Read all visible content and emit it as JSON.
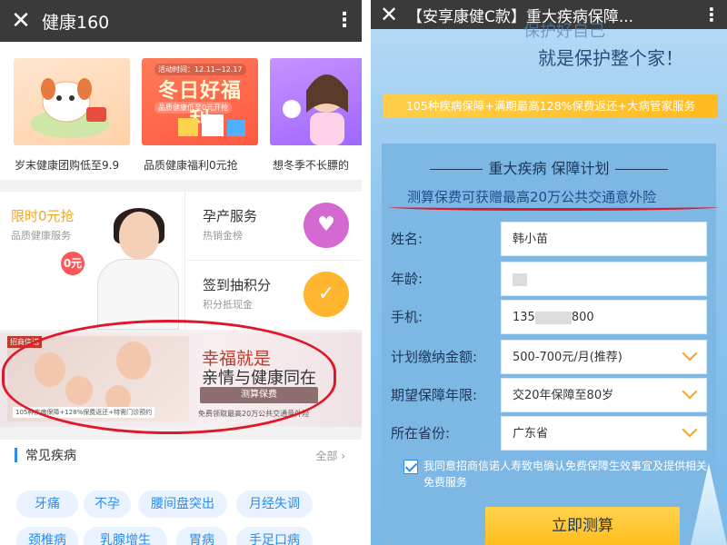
{
  "left": {
    "topbar": {
      "title": "健康160"
    },
    "banners": [
      {
        "caption": "岁末健康团购低至9.9"
      },
      {
        "caption": "品质健康福利0元抢",
        "tag": "活动时间：12.11~12.17",
        "big": "冬日好福利",
        "sub": "品质健康低至0元开抢"
      },
      {
        "caption": "想冬季不长膘的"
      }
    ],
    "grid": {
      "free": {
        "title": "限时0元抢",
        "sub": "品质健康服务",
        "badge": "0元"
      },
      "maternity": {
        "title": "孕产服务",
        "sub": "热销金榜"
      },
      "checkin": {
        "title": "签到抽积分",
        "sub": "积分抵现金"
      }
    },
    "ad": {
      "brand": "招商信诺",
      "line1": "幸福就是",
      "line2": "亲情与健康同在",
      "button": "测算保费",
      "foot_left": "105种疾病保障+128%保费返还+特需门诊预约",
      "foot_right": "免费领取最高20万公共交通意外险"
    },
    "section": {
      "title": "常见疾病",
      "all": "全部"
    },
    "tags": [
      "牙痛",
      "不孕",
      "腰间盘突出",
      "月经失调",
      "颈椎病",
      "乳腺增生",
      "胃病",
      "手足口病"
    ]
  },
  "right": {
    "topbar": {
      "title": "【安享康健C款】重大疾病保障..."
    },
    "slogan_faded": "保护好自己",
    "slogan": "就是保护整个家！",
    "ribbon": "105种疾病保障+满期最高128%保费返还+大病管家服务",
    "form": {
      "heading": "重大疾病 保障计划",
      "promo": "测算保费可获赠最高20万公共交通意外险",
      "fields": [
        {
          "label": "姓名:",
          "value": "韩小苗"
        },
        {
          "label": "年龄:",
          "value": ""
        },
        {
          "label": "手机:",
          "value_prefix": "135",
          "value_suffix": "800"
        },
        {
          "label": "计划缴纳金额:",
          "value": "500-700元/月(推荐)"
        },
        {
          "label": "期望保障年限:",
          "value": "交20年保障至80岁"
        },
        {
          "label": "所在省份:",
          "value": "广东省"
        }
      ],
      "agree": "我同意招商信诺人寿致电确认免费保障生效事宜及提供相关免费服务",
      "submit": "立即测算"
    }
  },
  "colors": {
    "accent_blue": "#2d8cf0",
    "highlight_red": "#e0172a",
    "cta_yellow": "#ffbe1f"
  }
}
